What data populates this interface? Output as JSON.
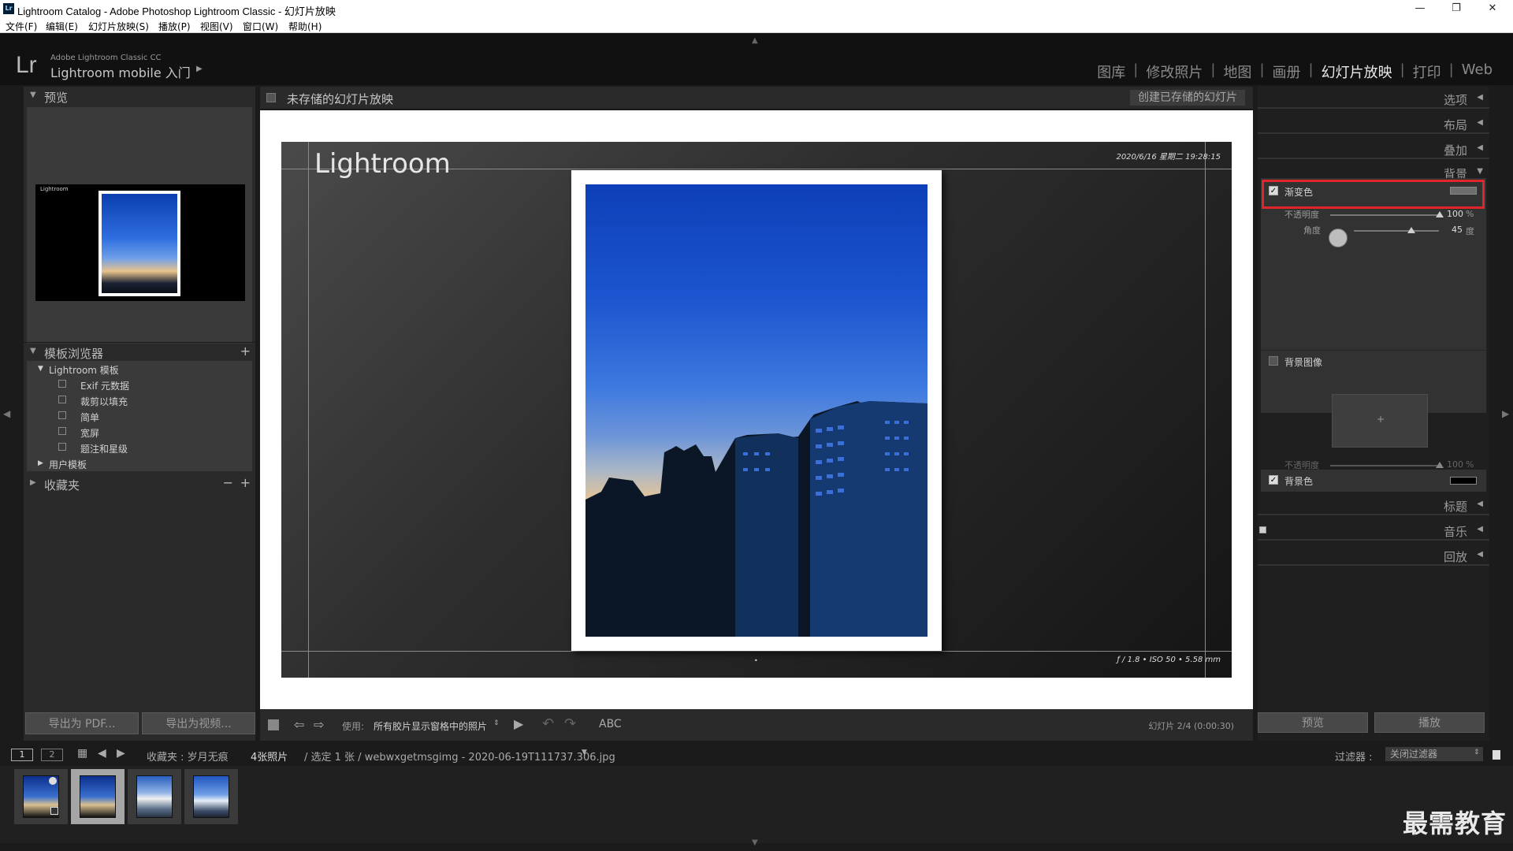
{
  "window": {
    "app_icon": "Lr",
    "title": "Lightroom Catalog - Adobe Photoshop Lightroom Classic - 幻灯片放映",
    "controls": [
      "—",
      "❐",
      "✕"
    ]
  },
  "menu": [
    "文件(F)",
    "编辑(E)",
    "幻灯片放映(S)",
    "播放(P)",
    "视图(V)",
    "窗口(W)",
    "帮助(H)"
  ],
  "identity": {
    "logo": "Lr",
    "line1": "Adobe Lightroom Classic CC",
    "line2": "Lightroom mobile 入门",
    "arrow": "▶"
  },
  "modules": {
    "items": [
      "图库",
      "修改照片",
      "地图",
      "画册",
      "幻灯片放映",
      "打印",
      "Web"
    ],
    "active": "幻灯片放映",
    "separator": "|"
  },
  "left_panel": {
    "navigator_title": "预览",
    "navigator_slide_label": "Lightroom",
    "template_browser_title": "模板浏览器",
    "template_group": "Lightroom 模板",
    "templates": [
      "Exif 元数据",
      "裁剪以填充",
      "简单",
      "宽屏",
      "题注和星级"
    ],
    "user_templates": "用户模板",
    "collections_title": "收藏夹",
    "plus": "+",
    "minus": "−",
    "export_pdf": "导出为 PDF...",
    "export_video": "导出为视频..."
  },
  "center": {
    "document_title": "未存储的幻灯片放映",
    "create_saved": "创建已存储的幻灯片",
    "slide_title": "Lightroom",
    "slide_date": "2020/6/16 星期二  19:28:15",
    "slide_exif": "ƒ / 1.8 • ISO 50 • 5.58 mm",
    "slide_dot": "•",
    "toolbar": {
      "use_label": "使用:",
      "use_value": "所有胶片显示窗格中的照片",
      "abc": "ABC",
      "slide_counter": "幻灯片 2/4 (0:00:30)"
    }
  },
  "right_panel": {
    "sections": [
      {
        "label": "选项",
        "arrow": "◀"
      },
      {
        "label": "布局",
        "arrow": "◀"
      },
      {
        "label": "叠加",
        "arrow": "◀"
      },
      {
        "label": "背景",
        "arrow": "▼"
      },
      {
        "label": "标题",
        "arrow": "◀"
      },
      {
        "label": "音乐",
        "arrow": "◀"
      },
      {
        "label": "回放",
        "arrow": "◀"
      }
    ],
    "background": {
      "gradient_label": "渐变色",
      "gradient_checked": true,
      "opacity_label": "不透明度",
      "opacity_value": "100",
      "opacity_unit": "%",
      "angle_label": "角度",
      "angle_value": "45",
      "angle_unit": "度",
      "bg_image_label": "背景图像",
      "bg_image_checked": false,
      "bg_image_opacity_label": "不透明度",
      "bg_image_opacity_value": "100",
      "bg_image_opacity_unit": "%",
      "bg_color_label": "背景色",
      "bg_color_checked": true,
      "well_plus": "+"
    },
    "preview_button": "预览",
    "play_button": "播放"
  },
  "filmstrip": {
    "page1": "1",
    "page2": "2",
    "source": "收藏夹 : 岁月无痕",
    "count": "4张照片",
    "selection": "/ 选定 1 张 / webwxgetmsgimg - 2020-06-19T111737.306.jpg",
    "filter_label": "过滤器 :",
    "filter_value": "关闭过滤器"
  },
  "watermark": "最需教育",
  "colors": {
    "highlight_box": "#e0252b",
    "active_module": "#e8e8e8"
  }
}
